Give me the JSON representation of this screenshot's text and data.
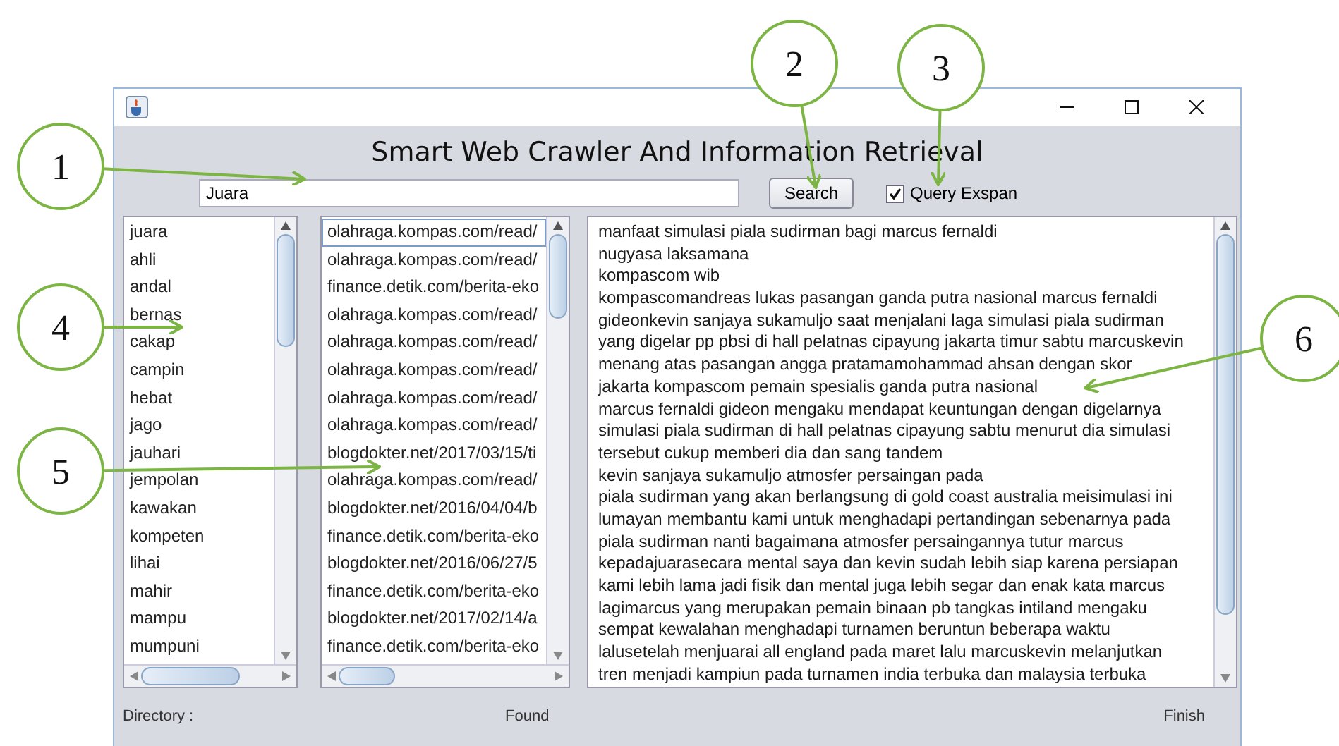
{
  "app_title": "Smart Web Crawler And Information Retrieval",
  "search": {
    "value": "Juara",
    "button": "Search"
  },
  "query_expansion": {
    "label": "Query Exspan",
    "checked": true
  },
  "word_list": [
    "juara",
    "ahli",
    "andal",
    "bernas",
    "cakap",
    "campin",
    "hebat",
    "jago",
    "jauhari",
    "jempolan",
    "kawakan",
    "kompeten",
    "lihai",
    "mahir",
    "mampu",
    "mumpuni"
  ],
  "url_list": [
    {
      "text": "olahraga.kompas.com/read/",
      "selected": true
    },
    {
      "text": "olahraga.kompas.com/read/",
      "selected": false
    },
    {
      "text": "finance.detik.com/berita-eko",
      "selected": false
    },
    {
      "text": "olahraga.kompas.com/read/",
      "selected": false
    },
    {
      "text": "olahraga.kompas.com/read/",
      "selected": false
    },
    {
      "text": "olahraga.kompas.com/read/",
      "selected": false
    },
    {
      "text": "olahraga.kompas.com/read/",
      "selected": false
    },
    {
      "text": "olahraga.kompas.com/read/",
      "selected": false
    },
    {
      "text": "blogdokter.net/2017/03/15/ti",
      "selected": false
    },
    {
      "text": "olahraga.kompas.com/read/",
      "selected": false
    },
    {
      "text": "blogdokter.net/2016/04/04/b",
      "selected": false
    },
    {
      "text": "finance.detik.com/berita-eko",
      "selected": false
    },
    {
      "text": "blogdokter.net/2016/06/27/5",
      "selected": false
    },
    {
      "text": "finance.detik.com/berita-eko",
      "selected": false
    },
    {
      "text": "blogdokter.net/2017/02/14/a",
      "selected": false
    },
    {
      "text": "finance.detik.com/berita-eko",
      "selected": false
    }
  ],
  "document_text": [
    "manfaat simulasi piala sudirman bagi marcus fernaldi",
    "nugyasa laksamana",
    "kompascom    wib",
    "kompascomandreas lukas pasangan ganda putra nasional marcus fernaldi",
    "gideonkevin sanjaya sukamuljo saat menjalani laga simulasi piala sudirman",
    "yang digelar pp pbsi di hall pelatnas cipayung jakarta timur sabtu  marcuskevin",
    "menang atas pasangan angga pratamamohammad ahsan dengan skor",
    "jakarta kompascom  pemain spesialis ganda putra nasional",
    "marcus fernaldi gideon mengaku mendapat keuntungan dengan digelarnya",
    "simulasi piala sudirman di hall pelatnas cipayung sabtu menurut dia simulasi",
    "tersebut cukup memberi dia dan sang tandem",
    "kevin sanjaya sukamuljo atmosfer persaingan pada",
    "piala sudirman  yang akan berlangsung di gold coast australia  meisimulasi ini",
    "lumayan membantu kami untuk menghadapi pertandingan sebenarnya pada",
    "piala sudirman nanti bagaimana atmosfer persaingannya tutur marcus",
    "kepadajuarasecara mental saya dan kevin sudah lebih siap karena persiapan",
    "kami lebih lama jadi fisik dan mental juga lebih segar dan enak kata marcus",
    "lagimarcus yang merupakan pemain binaan pb tangkas intiland mengaku",
    "sempat kewalahan menghadapi turnamen beruntun beberapa waktu",
    "lalusetelah menjuarai all england  pada maret lalu marcuskevin melanjutkan",
    "tren menjadi kampiun pada turnamen india terbuka dan malaysia terbuka"
  ],
  "status_bar": [
    "Directory :",
    "Found",
    "Finish"
  ],
  "callouts": [
    "1",
    "2",
    "3",
    "4",
    "5",
    "6"
  ]
}
